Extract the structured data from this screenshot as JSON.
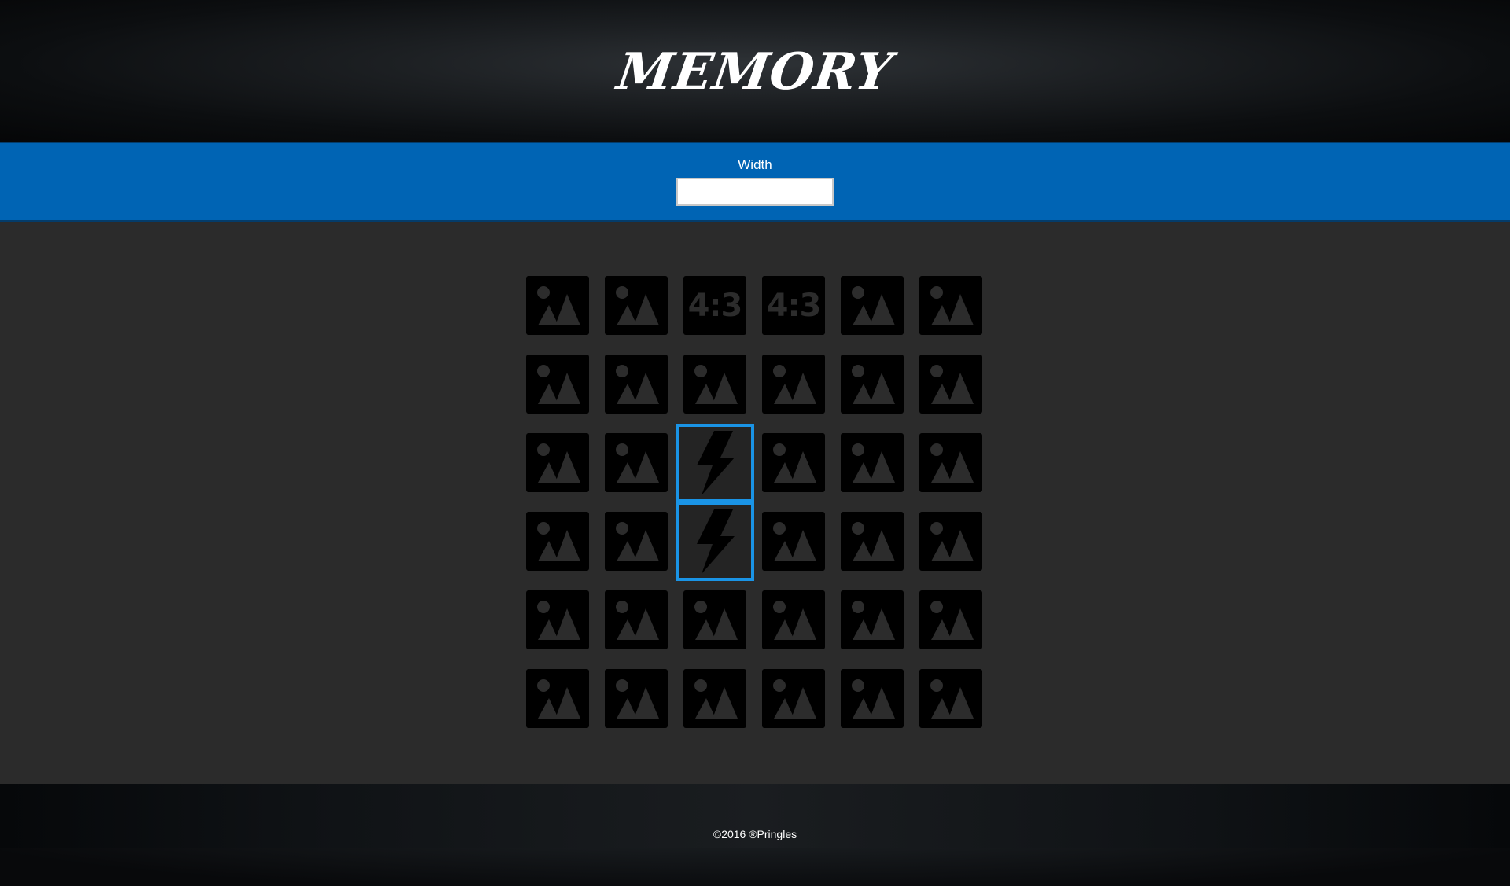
{
  "header": {
    "title": "MEMORY"
  },
  "controls": {
    "width_label": "Width",
    "width_value": "",
    "width_placeholder": ""
  },
  "board": {
    "columns": 6,
    "rows": 6,
    "cards": [
      [
        "image",
        "image",
        "ratio",
        "ratio",
        "image",
        "image"
      ],
      [
        "image",
        "image",
        "image",
        "image",
        "image",
        "image"
      ],
      [
        "image",
        "image",
        "bolt",
        "image",
        "image",
        "image"
      ],
      [
        "image",
        "image",
        "bolt",
        "image",
        "image",
        "image"
      ],
      [
        "image",
        "image",
        "image",
        "image",
        "image",
        "image"
      ],
      [
        "image",
        "image",
        "image",
        "image",
        "image",
        "image"
      ]
    ],
    "ratio_text": "4:3",
    "icons": {
      "image": "image-placeholder-icon",
      "ratio": "aspect-ratio-icon",
      "bolt": "lightning-bolt-icon"
    },
    "selected_color": "#1a94e6"
  },
  "colors": {
    "accent": "#0064b4",
    "board_bg": "#2b2b2b",
    "card_bg": "#000000",
    "icon": "#2c2c2c"
  },
  "footer": {
    "copyright": "©2016 ®Pringles"
  }
}
